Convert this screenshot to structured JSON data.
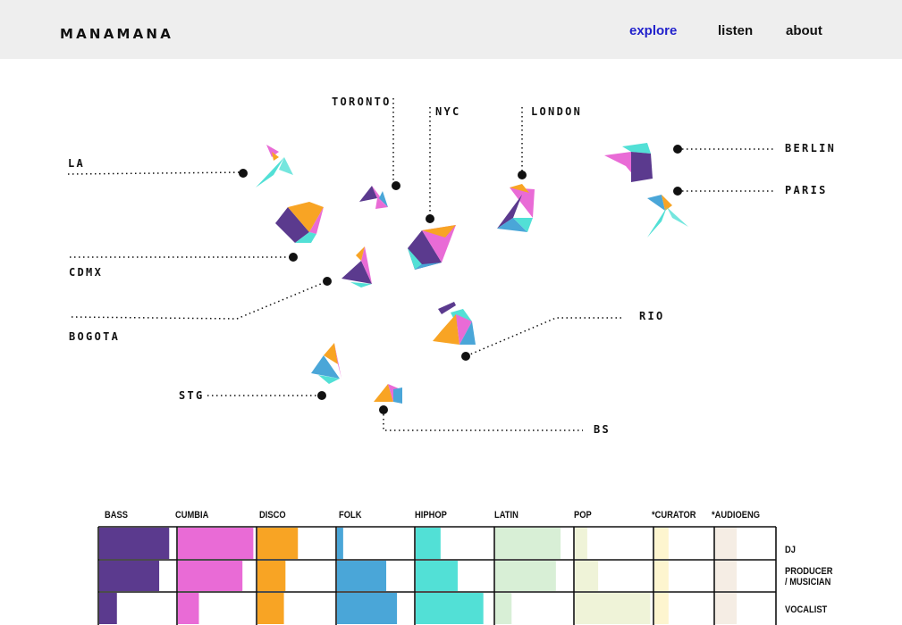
{
  "header": {
    "logo": "MANAMANA",
    "nav": [
      {
        "label": "explore",
        "active": true
      },
      {
        "label": "listen",
        "active": false
      },
      {
        "label": "about",
        "active": false
      }
    ]
  },
  "map": {
    "cities": [
      "TORONTO",
      "NYC",
      "LONDON",
      "BERLIN",
      "PARIS",
      "LA",
      "CDMX",
      "BOGOTA",
      "RIO",
      "STG",
      "BS"
    ],
    "shape_colors": {
      "purple": "#5b3a8e",
      "pink": "#e96bd6",
      "orange": "#f8a424",
      "blue": "#4aa6d8",
      "teal": "#52e0d6"
    }
  },
  "chart_data": {
    "type": "heatmap",
    "categories": [
      "BASS",
      "CUMBIA",
      "DISCO",
      "FOLK",
      "HIPHOP",
      "LATIN",
      "POP",
      "*CURATOR",
      "*AUDIOENG"
    ],
    "rows": [
      "DJ",
      "PRODUCER\n/ MUSICIAN",
      "VOCALIST"
    ],
    "colors": [
      "#5b3a8e",
      "#e96bd6",
      "#f8a424",
      "#4aa6d8",
      "#52e0d6",
      "#d8efd6",
      "#eff3d8",
      "#fdf5cf",
      "#f5ede4"
    ],
    "values": [
      [
        0.91,
        0.97,
        0.52,
        0.08,
        0.32,
        0.84,
        0.16,
        0.24,
        0.36
      ],
      [
        0.78,
        0.83,
        0.36,
        0.64,
        0.54,
        0.78,
        0.3,
        0.24,
        0.36
      ],
      [
        0.23,
        0.27,
        0.34,
        0.78,
        0.87,
        0.21,
        0.97,
        0.24,
        0.36
      ]
    ]
  }
}
